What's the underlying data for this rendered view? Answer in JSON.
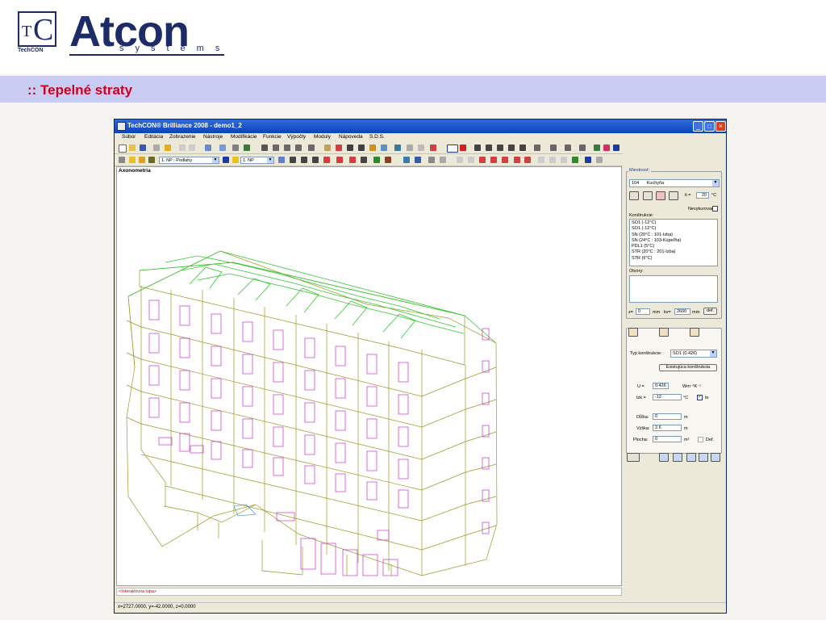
{
  "slide": {
    "logo_tc": "TC",
    "logo_caption": "TechCON",
    "brand_name": "Atcon",
    "brand_sub": "systems",
    "title": ":: Tepelné straty"
  },
  "window": {
    "title": "TechCON® Brilliance 2008  - demo1_2",
    "controls": [
      "_",
      "□",
      "×"
    ],
    "menu": [
      "Súbor",
      "Editácia",
      "Zobrazenie",
      "Nástroje",
      "Modifikácie",
      "Funkcie",
      "Výpočty",
      "Moduly",
      "Nápoveda",
      "S.D.S."
    ],
    "toolbar2": {
      "floor_select": "1. NP : Podlahy",
      "level_select": "1. NP"
    },
    "canvas_label": "Axonometria",
    "info_text": "<Interaktívna lupa>",
    "status_text": "x=2727.0000, y=-42.0000, z=0.0000"
  },
  "panel": {
    "room_label": "Miestnosť:",
    "room_number": "104",
    "room_name": "Kuchyňa",
    "ti_label": "ti =",
    "ti_value": "20",
    "ti_unit": "°C",
    "unheated_label": "Nevykurovaná",
    "constructions_label": "Konštrukcie:",
    "constructions": [
      "SO1  (-12°C)",
      "SO1  (-12°C)",
      "SN  (20°C : 101-Izba)",
      "SN  (24°C : 103-Kúpeľňa)",
      "PDL1  (5°C)",
      "STR  (20°C : 201-Izba)",
      "STR  (6°C)"
    ],
    "openings_label": "Otvory:",
    "z_label": "z=",
    "z_value": "0",
    "z_unit": "mm",
    "kv_label": "kv=",
    "kv_value": "2600",
    "kv_unit": "mm",
    "def_button": "def.",
    "type_label": "Typ konštrukcie:",
    "type_value": "SO1  (0.426)",
    "existing_button": "Existujúca konštrukcia",
    "u_label": "U  =",
    "u_value": "0.426",
    "u_unit": "Wm⁻²K⁻¹",
    "tzk_label": "tzk =",
    "tzk_value": "-12",
    "tzk_unit": "°C",
    "te_label": "te",
    "length_label": "Dĺžka:",
    "length_value": "0",
    "length_unit": "m",
    "height_label": "Výška:",
    "height_value": "2.6",
    "height_unit": "m",
    "area_label": "Plocha:",
    "area_value": "0",
    "area_unit": "m²",
    "area_def_label": "Def."
  },
  "colors": {
    "brand": "#1d2b67",
    "title_red": "#cc0022",
    "title_band": "#c9ccf2",
    "wall_line": "#9a9a20",
    "roof_line": "#32c832",
    "window_line": "#c832c8"
  }
}
